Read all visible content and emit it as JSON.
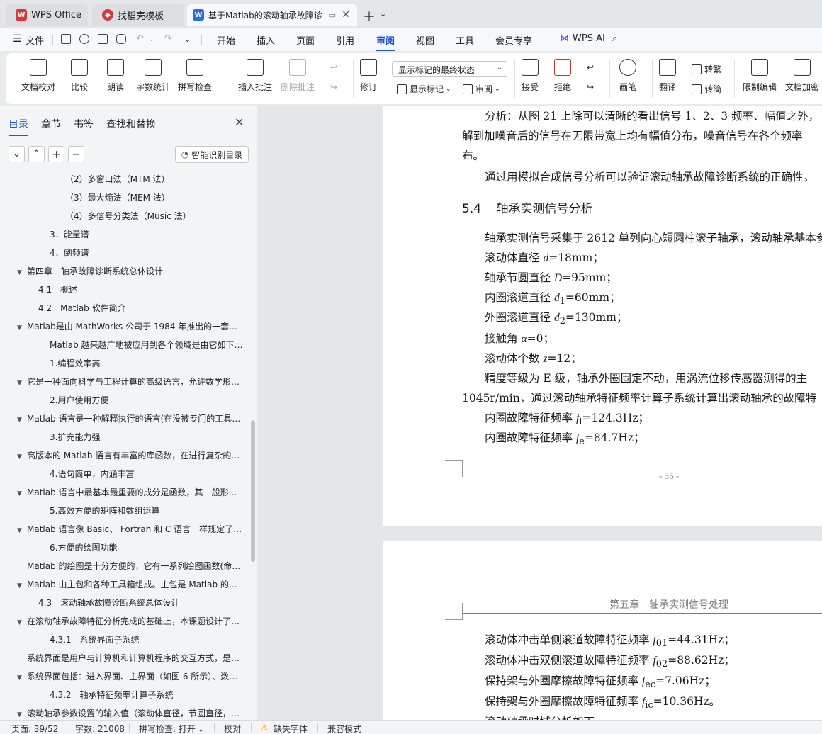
{
  "tabs": [
    {
      "label": "WPS Office",
      "icon": "wps-logo-icon",
      "color": "#d9373a"
    },
    {
      "label": "找稻壳模板",
      "icon": "docer-logo-icon",
      "color": "#d9373a"
    },
    {
      "label": "基于Matlab的滚动轴承故障诊",
      "icon": "word-doc-icon",
      "color": "#2b6ce0"
    }
  ],
  "menubar": {
    "file": "文件",
    "items": [
      "开始",
      "插入",
      "页面",
      "引用",
      "审阅",
      "视图",
      "工具",
      "会员专享"
    ],
    "active": "审阅",
    "wps_ai": "WPS AI"
  },
  "ribbon": {
    "doc_check": "文档校对",
    "compare": "比较",
    "read_aloud": "朗读",
    "word_count": "字数统计",
    "spell_check": "拼写检查",
    "insert_comment": "插入批注",
    "delete_comment": "删除批注",
    "revise": "修订",
    "markup_state": "显示标记的最终状态",
    "show_markup": "显示标记",
    "review": "审阅",
    "accept": "接受",
    "reject": "拒绝",
    "pen": "画笔",
    "translate": "翻译",
    "to_traditional": "转繁",
    "to_simplified": "转简",
    "restrict_edit": "限制编辑",
    "doc_encrypt": "文档加密"
  },
  "nav": {
    "tabs": [
      "目录",
      "章节",
      "书签",
      "查找和替换"
    ],
    "active_tab": "目录",
    "smart_toc": "智能识别目录",
    "items": [
      {
        "text": "（2）多窗口法（MTM 法）",
        "level": 4,
        "arrow": false
      },
      {
        "text": "（3）最大熵法（MEM 法）",
        "level": 4,
        "arrow": false
      },
      {
        "text": "（4）多信号分类法（Music 法）",
        "level": 4,
        "arrow": false
      },
      {
        "text": "3．能量谱",
        "level": 3,
        "arrow": false
      },
      {
        "text": "4．倒频谱",
        "level": 3,
        "arrow": false
      },
      {
        "text": "第四章　轴承故障诊断系统总体设计",
        "level": 1,
        "arrow": true
      },
      {
        "text": "4.1　概述",
        "level": 2,
        "arrow": false
      },
      {
        "text": "4.2　Matlab 软件简介",
        "level": 2,
        "arrow": false
      },
      {
        "text": "Matlab是由 MathWorks 公司于 1984 年推出的一套…",
        "level": 1,
        "arrow": true
      },
      {
        "text": "Matlab 越来越广地被应用到各个领域是由它如下…",
        "level": 3,
        "arrow": false
      },
      {
        "text": "1.编程效率高",
        "level": 3,
        "arrow": false
      },
      {
        "text": "它是一种面向科学与工程计算的高级语言，允许数学形…",
        "level": 1,
        "arrow": true
      },
      {
        "text": "2.用户使用方便",
        "level": 3,
        "arrow": false
      },
      {
        "text": "Matlab 语言是一种解释执行的语言(在没被专门的工具…",
        "level": 1,
        "arrow": true
      },
      {
        "text": "3.扩充能力强",
        "level": 3,
        "arrow": false
      },
      {
        "text": "高版本的 Matlab 语言有丰富的库函数，在进行复杂的…",
        "level": 1,
        "arrow": true
      },
      {
        "text": "4.语句简单，内涵丰富",
        "level": 3,
        "arrow": false
      },
      {
        "text": "Matlab 语言中最基本最重要的成分是函数，其一般形…",
        "level": 1,
        "arrow": true
      },
      {
        "text": "5.高效方便的矩阵和数组运算",
        "level": 3,
        "arrow": false
      },
      {
        "text": "Matlab 语言像 Basic、 Fortran 和 C 语言一样规定了…",
        "level": 1,
        "arrow": true
      },
      {
        "text": "6.方便的绘图功能",
        "level": 3,
        "arrow": false
      },
      {
        "text": "Matlab 的绘图是十分方便的，它有一系列绘图函数(命…",
        "level": 0,
        "arrow": false
      },
      {
        "text": "Matlab 由主包和各种工具箱组成。主包是 Matlab 的…",
        "level": 1,
        "arrow": true
      },
      {
        "text": "4.3　滚动轴承故障诊断系统总体设计",
        "level": 2,
        "arrow": false
      },
      {
        "text": "在滚动轴承故障特征分析完成的基础上，本课题设计了…",
        "level": 1,
        "arrow": true
      },
      {
        "text": "4.3.1　系统界面子系统",
        "level": 3,
        "arrow": false
      },
      {
        "text": "系统界面是用户与计算机和计算机程序的交互方式，是…",
        "level": 0,
        "arrow": false
      },
      {
        "text": "系统界面包括：进入界面、主界面（如图 6 所示）、数…",
        "level": 1,
        "arrow": true
      },
      {
        "text": "4.3.2　轴承特征频率计算子系统",
        "level": 3,
        "arrow": false
      },
      {
        "text": "滚动轴承参数设置的输入值（滚动体直径，节圆直径，…",
        "level": 1,
        "arrow": true
      }
    ]
  },
  "doc": {
    "page1": {
      "p1a": "分析：从图 21 上除可以清晰的看出信号 1、2、3 频率、幅值之外，",
      "p1b": "解到加噪音后的信号在无限带宽上均有幅值分布，噪音信号在各个频率",
      "p1c": "布。",
      "p2": "通过用模拟合成信号分析可以验证滚动轴承故障诊断系统的正确性。",
      "heading_num": "5.4",
      "heading": "轴承实测信号分析",
      "p3": "轴承实测信号采集于 2612 单列向心短圆柱滚子轴承，滚动轴承基本参",
      "l1_label": "滚动体直径",
      "l1_sym": "d",
      "l1_val": "=18mm；",
      "l2_label": "轴承节圆直径",
      "l2_sym": "D",
      "l2_val": "=95mm；",
      "l3_label": "内圈滚道直径",
      "l3_sym": "d",
      "l3_sub": "1",
      "l3_val": "=60mm；",
      "l4_label": "外圈滚道直径",
      "l4_sym": "d",
      "l4_sub": "2",
      "l4_val": "=130mm；",
      "l5_label": "接触角",
      "l5_sym": "α",
      "l5_val": "=0；",
      "l6_label": "滚动体个数",
      "l6_sym": "z",
      "l6_val": "=12；",
      "p4a": "精度等级为 E 级，轴承外圈固定不动，用涡流位移传感器测得的主",
      "p4b": "1045r/min，通过滚动轴承特征频率计算子系统计算出滚动轴承的故障特",
      "f1_label": "内圈故障特征频率",
      "f1_sym": "f",
      "f1_sub": "i",
      "f1_val": "=124.3Hz；",
      "f2_label": "内圈故障特征频率",
      "f2_sym": "f",
      "f2_sub": "e",
      "f2_val": "=84.7Hz；",
      "page_number": "- 35 -"
    },
    "page2": {
      "header": "第五章　轴承实测信号处理",
      "g1_label": "滚动体冲击单侧滚道故障特征频率",
      "g1_sym": "f",
      "g1_sub": "01",
      "g1_val": "=44.31Hz；",
      "g2_label": "滚动体冲击双侧滚道故障特征频率",
      "g2_sym": "f",
      "g2_sub": "02",
      "g2_val": "=88.62Hz；",
      "g3_label": "保持架与外圈摩擦故障特征频率",
      "g3_sym": "f",
      "g3_sub": "ec",
      "g3_val": "=7.06Hz；",
      "g4_label": "保持架与外圈摩擦故障特征频率",
      "g4_sym": "f",
      "g4_sub": "ic",
      "g4_val": "=10.36Hz。",
      "last": "滚动轴承时域分析如下"
    }
  },
  "status": {
    "page": "页面: 39/52",
    "words": "字数: 21008",
    "spell": "拼写检查: 打开",
    "proof": "校对",
    "missing_font": "缺失字体",
    "compat": "兼容模式"
  },
  "colors": {
    "accent": "#1a56db",
    "warning": "#e8a317"
  }
}
